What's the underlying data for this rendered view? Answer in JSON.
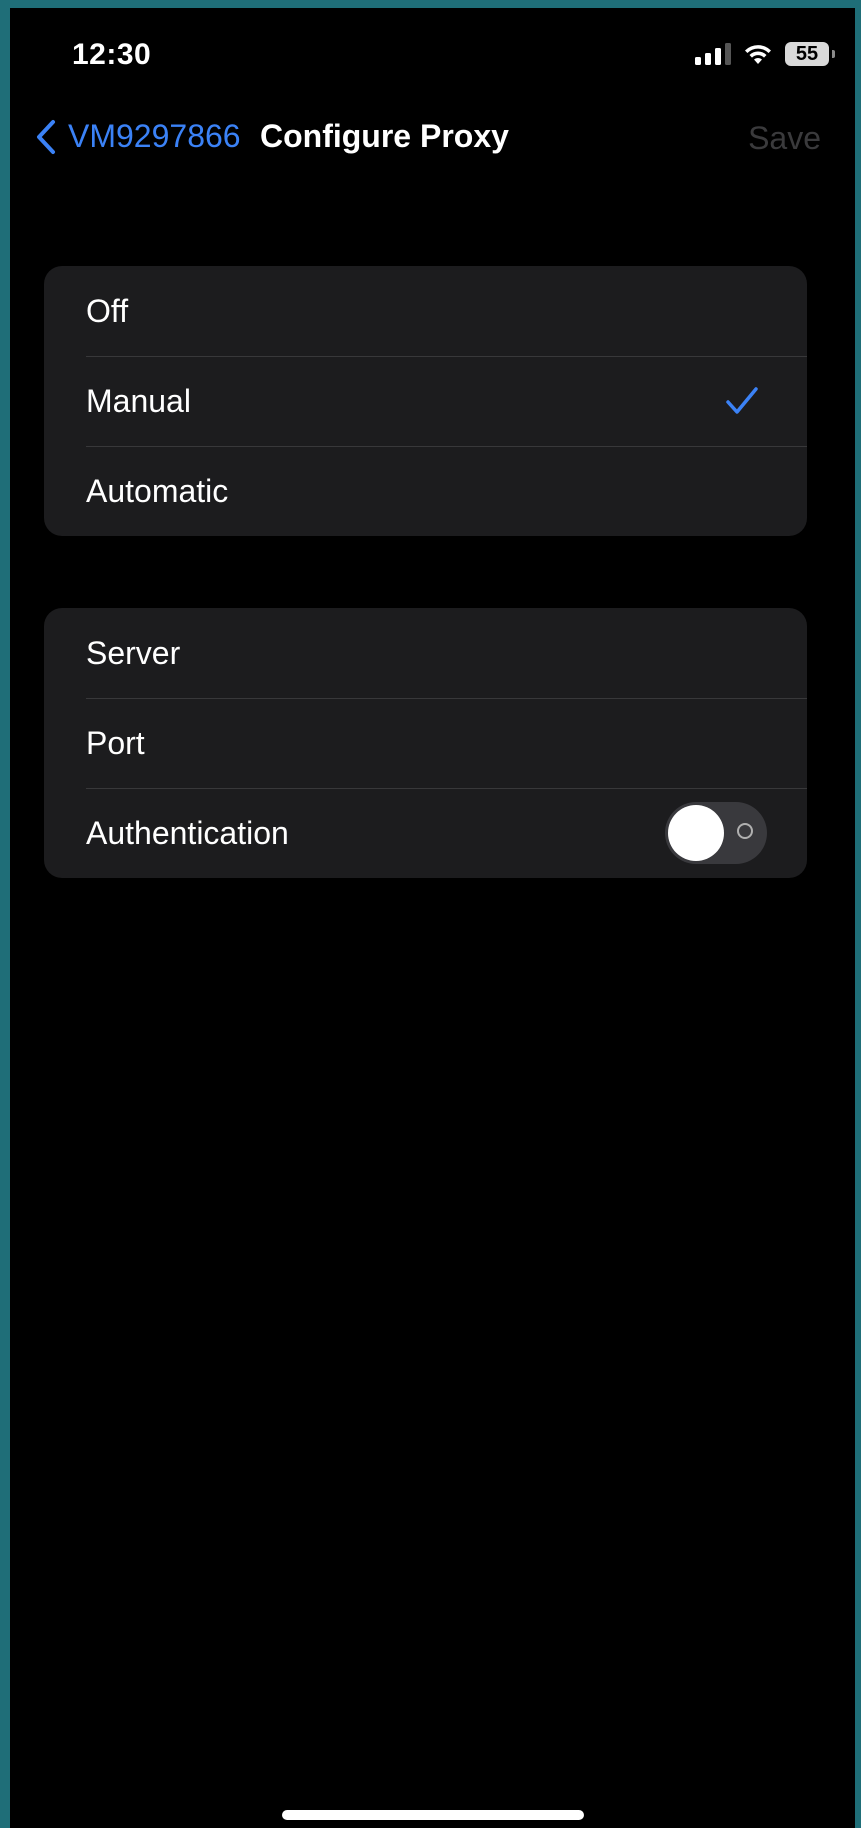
{
  "status_bar": {
    "time": "12:30",
    "battery_level": "55",
    "signal_icon": "cellular-signal-icon",
    "wifi_icon": "wifi-icon"
  },
  "nav": {
    "back_label": "VM9297866",
    "title": "Configure Proxy",
    "save_label": "Save",
    "accent_color": "#3b82f6"
  },
  "proxy_modes": {
    "options": [
      {
        "label": "Off",
        "selected": false
      },
      {
        "label": "Manual",
        "selected": true
      },
      {
        "label": "Automatic",
        "selected": false
      }
    ]
  },
  "manual_settings": {
    "server_label": "Server",
    "port_label": "Port",
    "authentication_label": "Authentication",
    "authentication_enabled": false
  }
}
